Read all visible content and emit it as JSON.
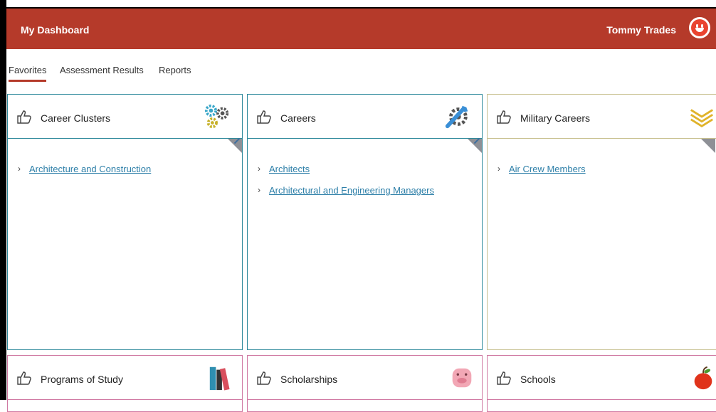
{
  "header": {
    "title": "My Dashboard",
    "user_name": "Tommy Trades"
  },
  "tabs": [
    {
      "label": "Favorites",
      "active": true
    },
    {
      "label": "Assessment Results",
      "active": false
    },
    {
      "label": "Reports",
      "active": false
    }
  ],
  "cards": [
    {
      "title": "Career Clusters",
      "icon": "gears-icon",
      "links": [
        "Architecture and Construction"
      ]
    },
    {
      "title": "Careers",
      "icon": "wrench-gear-icon",
      "links": [
        "Architects",
        "Architectural and Engineering Managers"
      ]
    },
    {
      "title": "Military Careers",
      "icon": "chevron-rank-icon",
      "links": [
        "Air Crew Members"
      ]
    },
    {
      "title": "Programs of Study",
      "icon": "books-icon",
      "links": []
    },
    {
      "title": "Scholarships",
      "icon": "piggy-bank-icon",
      "links": []
    },
    {
      "title": "Schools",
      "icon": "apple-icon",
      "links": []
    }
  ],
  "colors": {
    "header": "#b53a2a",
    "teal_border": "#2f8a9c",
    "olive_border": "#c7c08f",
    "pink_border": "#d07aa3",
    "link": "#2d7fa8"
  }
}
